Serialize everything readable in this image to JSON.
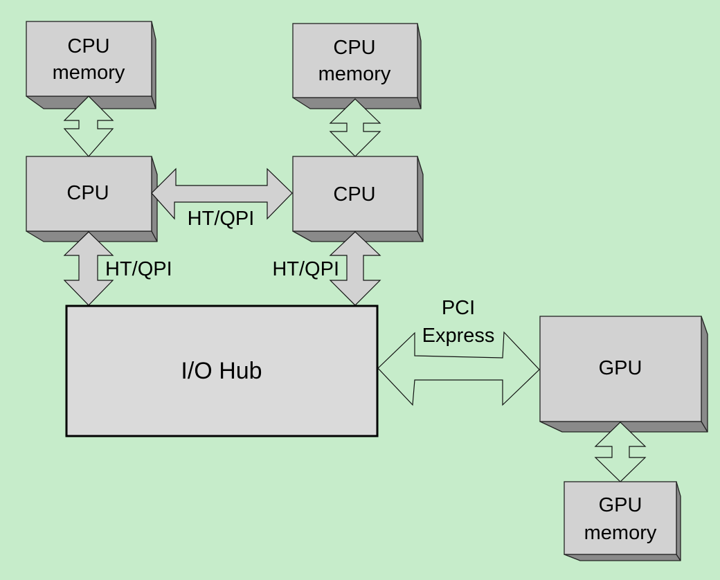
{
  "diagram": {
    "background_color": "#c6ecca",
    "box_color": "#d2d2d2",
    "box_shadow_color": "#8a8a8a",
    "nodes": {
      "cpu_memory_left": {
        "lines": [
          "CPU",
          "memory"
        ]
      },
      "cpu_memory_right": {
        "lines": [
          "CPU",
          "memory"
        ]
      },
      "cpu_left": {
        "lines": [
          "CPU"
        ]
      },
      "cpu_right": {
        "lines": [
          "CPU"
        ]
      },
      "io_hub": {
        "lines": [
          "I/O Hub"
        ]
      },
      "gpu": {
        "lines": [
          "GPU"
        ]
      },
      "gpu_memory": {
        "lines": [
          "GPU",
          "memory"
        ]
      }
    },
    "links": {
      "cpu_to_cpu": {
        "label": "HT/QPI",
        "from": "cpu_left",
        "to": "cpu_right",
        "style": "filled"
      },
      "cpu_left_to_hub": {
        "label": "HT/QPI",
        "from": "cpu_left",
        "to": "io_hub",
        "style": "filled"
      },
      "cpu_right_to_hub": {
        "label": "HT/QPI",
        "from": "cpu_right",
        "to": "io_hub",
        "style": "filled"
      },
      "hub_to_gpu": {
        "lines": [
          "PCI",
          "Express"
        ],
        "from": "io_hub",
        "to": "gpu",
        "style": "hollow"
      },
      "mem_left_to_cpu": {
        "label": "",
        "from": "cpu_memory_left",
        "to": "cpu_left",
        "style": "hollow"
      },
      "mem_right_to_cpu": {
        "label": "",
        "from": "cpu_memory_right",
        "to": "cpu_right",
        "style": "hollow"
      },
      "gpu_to_gpu_memory": {
        "label": "",
        "from": "gpu",
        "to": "gpu_memory",
        "style": "hollow"
      }
    }
  }
}
